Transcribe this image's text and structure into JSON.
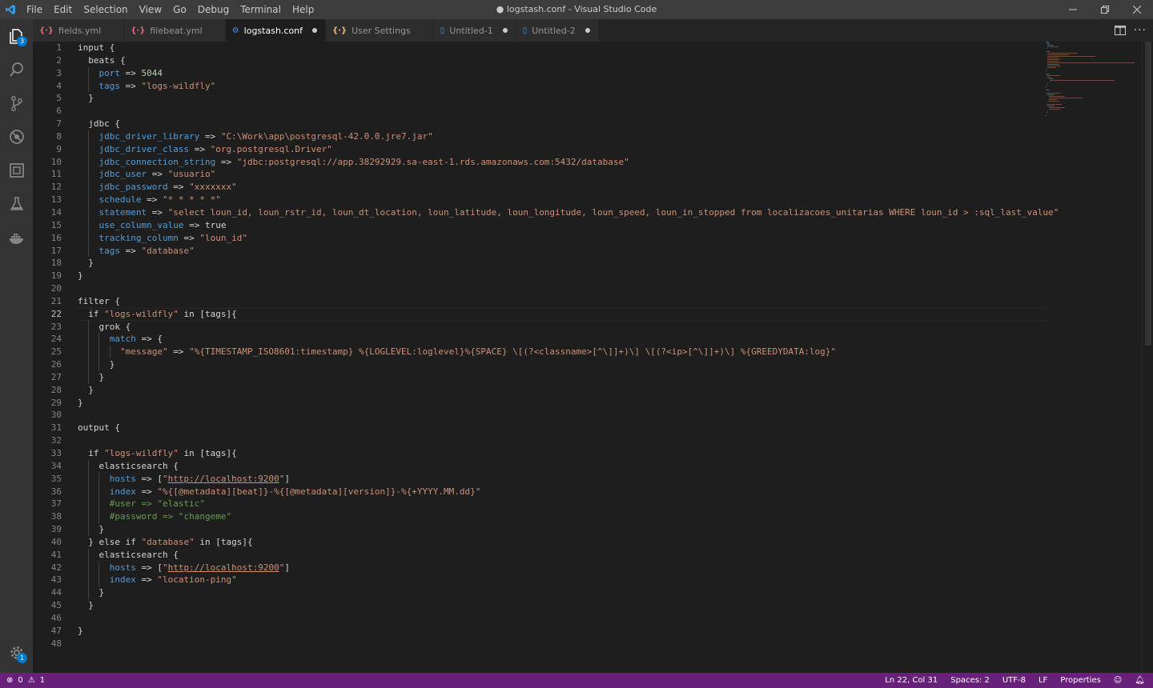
{
  "window": {
    "title": "● logstash.conf - Visual Studio Code"
  },
  "menu": [
    "File",
    "Edit",
    "Selection",
    "View",
    "Go",
    "Debug",
    "Terminal",
    "Help"
  ],
  "activity": {
    "explorer_badge": "3",
    "manage_badge": "1"
  },
  "tabs": [
    {
      "icon": "{·}",
      "label": "fields.yml",
      "icon_color": "#e06c75",
      "dirty": false,
      "active": false
    },
    {
      "icon": "{·}",
      "label": "filebeat.yml",
      "icon_color": "#e06c75",
      "dirty": false,
      "active": false
    },
    {
      "icon": "⚙",
      "label": "logstash.conf",
      "icon_color": "#3b9cde",
      "dirty": true,
      "active": true
    },
    {
      "icon": "{·}",
      "label": "User Settings",
      "icon_color": "#e5c07b",
      "dirty": false,
      "active": false
    },
    {
      "icon": "▯",
      "label": "Untitled-1",
      "icon_color": "#3b9cde",
      "dirty": true,
      "active": false
    },
    {
      "icon": "▯",
      "label": "Untitled-2",
      "icon_color": "#3b9cde",
      "dirty": true,
      "active": false
    }
  ],
  "editor": {
    "active_line": 22,
    "lines": [
      "input {",
      "  beats {",
      "    port => 5044",
      "    tags => \"logs-wildfly\"",
      "  }",
      "",
      "  jdbc {",
      "    jdbc_driver_library => \"C:\\Work\\app\\postgresql-42.0.0.jre7.jar\"",
      "    jdbc_driver_class => \"org.postgresql.Driver\"",
      "    jdbc_connection_string => \"jdbc:postgresql://app.38292929.sa-east-1.rds.amazonaws.com:5432/database\"",
      "    jdbc_user => \"usuario\"",
      "    jdbc_password => \"xxxxxxx\"",
      "    schedule => \"* * * * *\"",
      "    statement => \"select loun_id, loun_rstr_id, loun_dt_location, loun_latitude, loun_longitude, loun_speed, loun_in_stopped from localizacoes_unitarias WHERE loun_id > :sql_last_value\"",
      "    use_column_value => true",
      "    tracking_column => \"loun_id\"",
      "    tags => \"database\"",
      "  }",
      "}",
      "",
      "filter {",
      "  if \"logs-wildfly\" in [tags]{",
      "    grok {",
      "      match => {",
      "        \"message\" => \"%{TIMESTAMP_ISO8601:timestamp} %{LOGLEVEL:loglevel}%{SPACE} \\[(?<classname>[^\\]]+)\\] \\[(?<ip>[^\\]]+)\\] %{GREEDYDATA:log}\"",
      "      }",
      "    }",
      "  }",
      "}",
      "",
      "output {",
      "",
      "  if \"logs-wildfly\" in [tags]{",
      "    elasticsearch {",
      "      hosts => [\"http://localhost:9200\"]",
      "      index => \"%{[@metadata][beat]}-%{[@metadata][version]}-%{+YYYY.MM.dd}\"",
      "      #user => \"elastic\"",
      "      #password => \"changeme\"",
      "    }",
      "  } else if \"database\" in [tags]{",
      "    elasticsearch {",
      "      hosts => [\"http://localhost:9200\"]",
      "      index => \"location-ping\"",
      "    }",
      "  }",
      "",
      "}",
      ""
    ]
  },
  "status": {
    "errors": "0",
    "warnings": "1",
    "position": "Ln 22, Col 31",
    "spaces": "Spaces: 2",
    "encoding": "UTF-8",
    "eol": "LF",
    "language": "Properties"
  },
  "colors": {
    "statusbar": "#68217a",
    "keyword": "#569cd6",
    "string": "#ce9178",
    "number": "#b5cea8",
    "comment": "#6a9955"
  }
}
